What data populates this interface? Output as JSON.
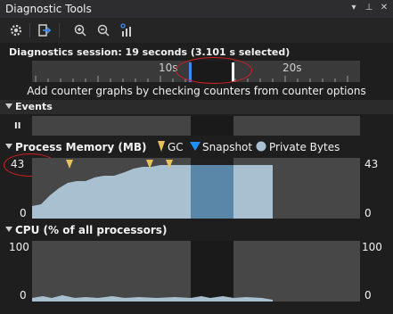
{
  "window": {
    "title": "Diagnostic Tools",
    "controls": [
      "▾",
      "⊥",
      "✕"
    ]
  },
  "toolbar": {
    "icons": [
      "gear-icon",
      "export-icon",
      "zoom-in-icon",
      "zoom-out-icon",
      "chart-settings-icon"
    ]
  },
  "session": {
    "text": "Diagnostics session: 19 seconds (3.101 s selected)"
  },
  "ruler": {
    "tick_10s": "10s",
    "tick_20s": "20s"
  },
  "hint": {
    "text": "Add counter graphs by checking counters from counter options"
  },
  "events": {
    "header": "Events",
    "pause_symbol": "II"
  },
  "memory": {
    "header": "Process Memory (MB)",
    "legend": {
      "gc": "GC",
      "snapshot": "Snapshot",
      "private_bytes": "Private Bytes"
    },
    "y_max_left": "43",
    "y_min_left": "0",
    "y_max_right": "43",
    "y_min_right": "0",
    "colors": {
      "area": "#a8c0d0",
      "gc": "#e8c15a",
      "snapshot": "#1e90ff",
      "selection": "#1a1a1a"
    }
  },
  "cpu": {
    "header": "CPU (% of all processors)",
    "y_max_left": "100",
    "y_min_left": "0",
    "y_max_right": "100",
    "y_min_right": "0"
  }
}
